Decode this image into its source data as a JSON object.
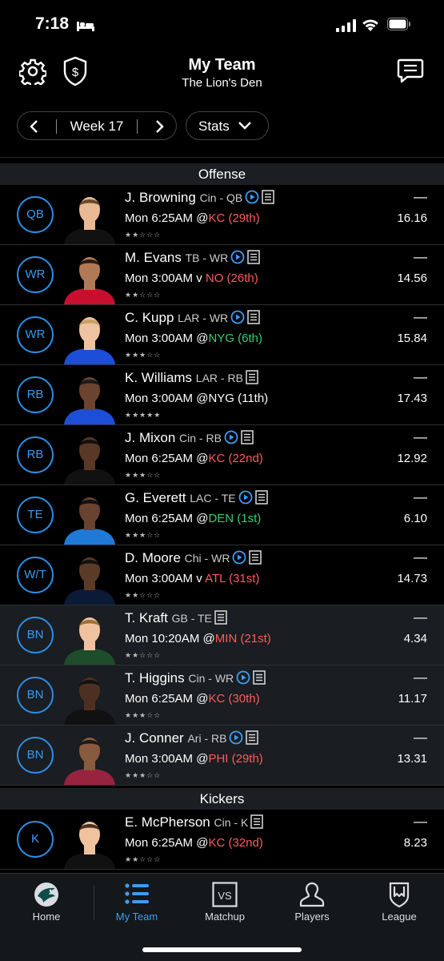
{
  "status_bar": {
    "time": "7:18"
  },
  "header": {
    "title": "My Team",
    "subtitle": "The Lion's Den"
  },
  "controls": {
    "week_label": "Week 17",
    "stats_label": "Stats"
  },
  "sections": {
    "offense": "Offense",
    "kickers": "Kickers"
  },
  "players": [
    {
      "pos": "QB",
      "name": "J. Browning",
      "team": "Cin - QB",
      "video": true,
      "time": "Mon 6:25AM @",
      "opp": "KC (29th)",
      "opp_color": "red",
      "stars": "★★☆☆☆",
      "proj": "—",
      "points": "16.16",
      "bench": false,
      "jersey": "#111111",
      "skin": "#e9b995",
      "hair": "#6b4a2b"
    },
    {
      "pos": "WR",
      "name": "M. Evans",
      "team": "TB - WR",
      "video": true,
      "time": "Mon 3:00AM v ",
      "opp": "NO (26th)",
      "opp_color": "red",
      "stars": "★★☆☆☆",
      "proj": "—",
      "points": "14.56",
      "bench": false,
      "jersey": "#c8102e",
      "skin": "#b07a55",
      "hair": "#2b1b12"
    },
    {
      "pos": "WR",
      "name": "C. Kupp",
      "team": "LAR - WR",
      "video": true,
      "time": "Mon 3:00AM @",
      "opp": "NYG (6th)",
      "opp_color": "green",
      "stars": "★★★☆☆",
      "proj": "—",
      "points": "15.84",
      "bench": false,
      "jersey": "#1d4ed8",
      "skin": "#efc3a0",
      "hair": "#c9a063"
    },
    {
      "pos": "RB",
      "name": "K. Williams",
      "team": "LAR - RB",
      "video": false,
      "time": "Mon 3:00AM @",
      "opp": "NYG (11th)",
      "opp_color": "none",
      "stars": "★★★★★",
      "proj": "—",
      "points": "17.43",
      "bench": false,
      "jersey": "#1d4ed8",
      "skin": "#6b4330",
      "hair": "#1a1a1a"
    },
    {
      "pos": "RB",
      "name": "J. Mixon",
      "team": "Cin - RB",
      "video": true,
      "time": "Mon 6:25AM @",
      "opp": "KC (22nd)",
      "opp_color": "red",
      "stars": "★★★☆☆",
      "proj": "—",
      "points": "12.92",
      "bench": false,
      "jersey": "#111111",
      "skin": "#5a3826",
      "hair": "#111111"
    },
    {
      "pos": "TE",
      "name": "G. Everett",
      "team": "LAC - TE",
      "video": true,
      "time": "Mon 6:25AM @",
      "opp": "DEN (1st)",
      "opp_color": "green",
      "stars": "★★★☆☆",
      "proj": "—",
      "points": "6.10",
      "bench": false,
      "jersey": "#1f7ad6",
      "skin": "#6a4230",
      "hair": "#111111"
    },
    {
      "pos": "W/T",
      "name": "D. Moore",
      "team": "Chi - WR",
      "video": true,
      "time": "Mon 3:00AM v ",
      "opp": "ATL (31st)",
      "opp_color": "red",
      "stars": "★★☆☆☆",
      "proj": "—",
      "points": "14.73",
      "bench": false,
      "jersey": "#0b1a36",
      "skin": "#5b3a28",
      "hair": "#111111"
    },
    {
      "pos": "BN",
      "name": "T. Kraft",
      "team": "GB - TE",
      "video": false,
      "time": "Mon 10:20AM @",
      "opp": "MIN (21st)",
      "opp_color": "red",
      "stars": "★★☆☆☆",
      "proj": "—",
      "points": "4.34",
      "bench": true,
      "jersey": "#1e4d2b",
      "skin": "#f0c2a0",
      "hair": "#a0703a"
    },
    {
      "pos": "BN",
      "name": "T. Higgins",
      "team": "Cin - WR",
      "video": true,
      "time": "Mon 6:25AM @",
      "opp": "KC (30th)",
      "opp_color": "red",
      "stars": "★★★☆☆",
      "proj": "—",
      "points": "11.17",
      "bench": true,
      "jersey": "#111111",
      "skin": "#4e3022",
      "hair": "#111111"
    },
    {
      "pos": "BN",
      "name": "J. Conner",
      "team": "Ari - RB",
      "video": true,
      "time": "Mon 3:00AM @",
      "opp": "PHI (29th)",
      "opp_color": "red",
      "stars": "★★★☆☆",
      "proj": "—",
      "points": "13.31",
      "bench": true,
      "jersey": "#97233f",
      "skin": "#8a5a3e",
      "hair": "#1a1a1a"
    }
  ],
  "kicker": {
    "pos": "K",
    "name": "E. McPherson",
    "team": "Cin - K",
    "video": false,
    "time": "Mon 6:25AM @",
    "opp": "KC (32nd)",
    "opp_color": "red",
    "stars": "★★☆☆☆",
    "proj": "—",
    "points": "8.23",
    "bench": false,
    "jersey": "#111111",
    "skin": "#efc3a0",
    "hair": "#4a3020"
  },
  "tabbar": {
    "home": "Home",
    "my_team": "My Team",
    "matchup": "Matchup",
    "players": "Players",
    "league": "League"
  },
  "icons": {
    "settings": "gear-icon",
    "dollar": "dollar-shield-icon",
    "chat": "chat-icon",
    "video": "play-circle-icon",
    "notes": "notes-icon",
    "home": "eagles-logo-icon",
    "my_team": "list-icon",
    "matchup": "vs-icon",
    "players": "player-icon",
    "league": "shield-flag-icon"
  },
  "colors": {
    "accent": "#3d9cf2",
    "bad_matchup": "#ff5a5a",
    "good_matchup": "#35d16b",
    "bench_bg": "#1a1d21",
    "section_bg": "#1b1e22"
  }
}
